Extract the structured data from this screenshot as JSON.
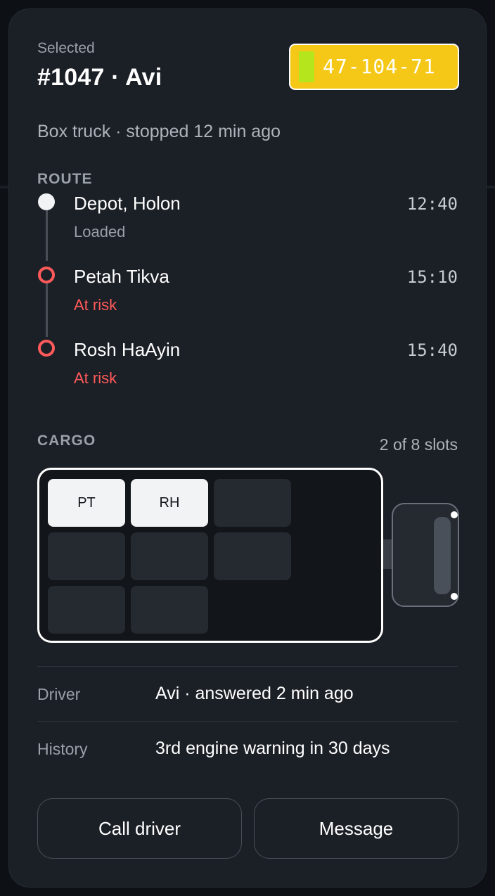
{
  "header": {
    "selected_label": "Selected",
    "title": "#1047 · Avi",
    "plate": "47-104-71",
    "subtitle": "Box truck · stopped 12 min ago"
  },
  "route": {
    "heading": "ROUTE",
    "stops": [
      {
        "name": "Depot, Holon",
        "status": "Loaded",
        "time": "12:40",
        "state": "done"
      },
      {
        "name": "Petah Tikva",
        "status": "At risk",
        "time": "15:10",
        "state": "risk"
      },
      {
        "name": "Rosh HaAyin",
        "status": "At risk",
        "time": "15:40",
        "state": "risk"
      }
    ]
  },
  "cargo": {
    "heading": "CARGO",
    "count": "2 of 8 slots",
    "slots": [
      "PT",
      "RH",
      "",
      "",
      "",
      "",
      "",
      ""
    ]
  },
  "info": {
    "driver_label": "Driver",
    "driver_value": "Avi · answered 2 min ago",
    "history_label": "History",
    "history_value": "3rd engine warning in 30 days"
  },
  "actions": {
    "call_label": "Call driver",
    "message_label": "Message"
  },
  "colors": {
    "accent_risk": "#ff5a5a",
    "plate_bg": "#f5c817",
    "plate_flag": "#b5e61d"
  }
}
